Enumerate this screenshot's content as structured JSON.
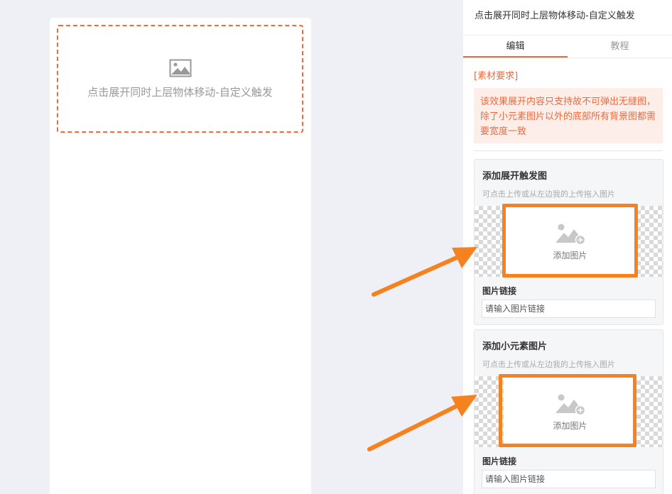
{
  "canvas": {
    "trigger_text": "点击展开同时上层物体移动-自定义触发",
    "trigger_icon": "image-icon"
  },
  "panel": {
    "title": "点击展开同时上层物体移动-自定义触发",
    "tabs": [
      {
        "label": "编辑",
        "active": true
      },
      {
        "label": "教程",
        "active": false
      }
    ],
    "requirement_label": "[素材要求]",
    "requirement_text": "该效果展开内容只支持故不可弹出无缝图，除了小元素图片以外的底部所有背景图都需要宽度一致",
    "sections": [
      {
        "title": "添加展开触发图",
        "hint": "可点击上传或从左边我的上传拖入图片",
        "upload_label": "添加图片",
        "upload_icon": "image-add-icon",
        "link_label": "图片链接",
        "link_placeholder": "请输入图片链接"
      },
      {
        "title": "添加小元素图片",
        "hint": "可点击上传或从左边我的上传拖入图片",
        "upload_label": "添加图片",
        "upload_icon": "image-add-icon",
        "link_label": "图片链接",
        "link_placeholder": "请输入图片链接"
      }
    ]
  },
  "colors": {
    "accent": "#f26a3b",
    "annotation": "#f5821f",
    "background": "#eef0f6"
  }
}
